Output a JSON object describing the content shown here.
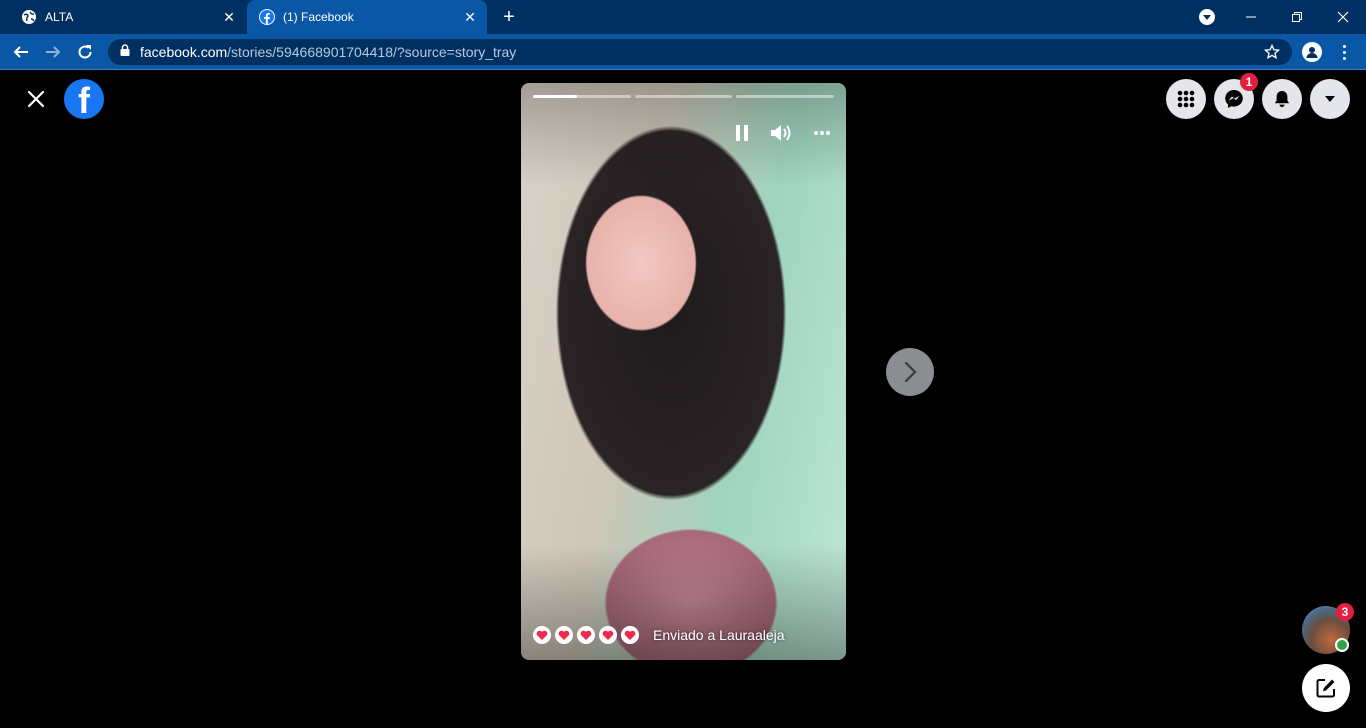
{
  "browser": {
    "tabs": [
      {
        "title": "ALTA",
        "favicon": "globe-icon"
      },
      {
        "title": "(1) Facebook",
        "favicon": "facebook-icon",
        "active": true
      }
    ],
    "new_tab_symbol": "+",
    "url_host": "facebook.com",
    "url_path": "/stories/594668901704418/?source=story_tray"
  },
  "header": {
    "logo": "facebook-logo",
    "logo_letter": "f",
    "messenger_badge": "1"
  },
  "story": {
    "progress": [
      0.45,
      0,
      0
    ],
    "controls": [
      "pause-icon",
      "volume-icon",
      "more-icon"
    ],
    "sent_text": "Enviado a Lauraaleja",
    "heart_count": 5
  },
  "chat": {
    "badge": "3"
  },
  "colors": {
    "chrome_dark": "#003062",
    "chrome_tab": "#0a57a6",
    "facebook_blue": "#1877f2",
    "badge_red": "#e41e3f",
    "online_green": "#31a24c"
  }
}
